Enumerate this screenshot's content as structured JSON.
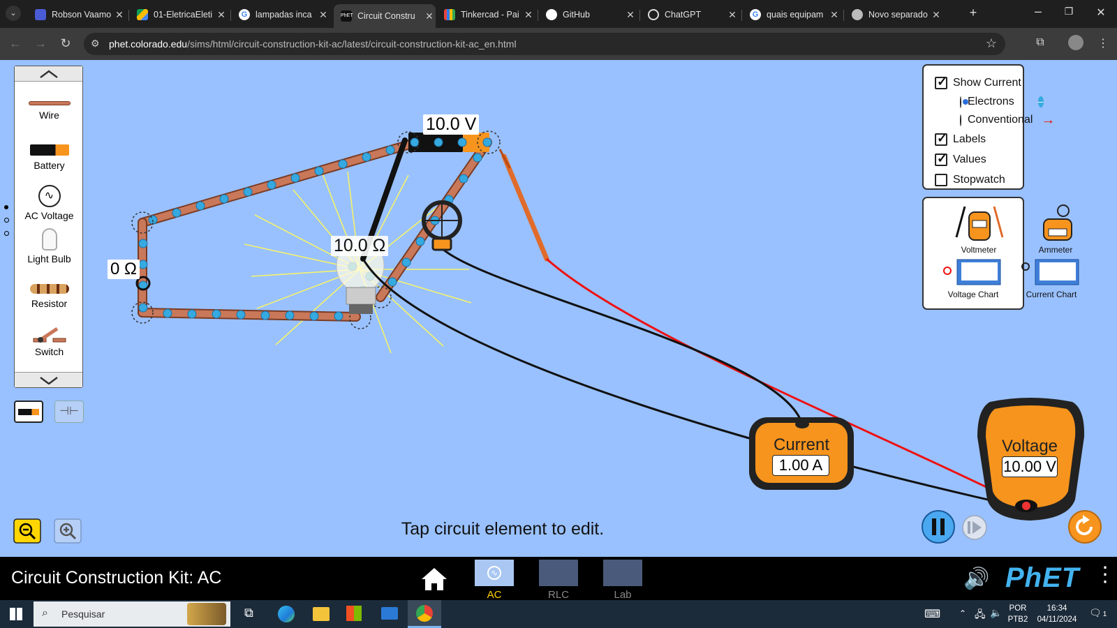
{
  "browser": {
    "tabs": [
      {
        "title": "Robson Vaamo",
        "color": "#4a5bd6"
      },
      {
        "title": "01-EletricaEleti",
        "color": "#34a853"
      },
      {
        "title": "lampadas inca",
        "color": "#ffffff"
      },
      {
        "title": "Circuit Constru",
        "color": "#111111"
      },
      {
        "title": "Tinkercad - Pai",
        "color": "#e8453c"
      },
      {
        "title": "GitHub",
        "color": "#ffffff"
      },
      {
        "title": "ChatGPT",
        "color": "#ffffff"
      },
      {
        "title": "quais equipam",
        "color": "#ffffff"
      },
      {
        "title": "Novo separado",
        "color": "#ffffff"
      }
    ],
    "url_domain": "phet.colorado.edu",
    "url_path": "/sims/html/circuit-construction-kit-ac/latest/circuit-construction-kit-ac_en.html"
  },
  "toolbox": {
    "items": [
      "Wire",
      "Battery",
      "AC Voltage",
      "Light Bulb",
      "Resistor",
      "Switch"
    ]
  },
  "options": {
    "show_current": "Show Current",
    "electrons": "Electrons",
    "conventional": "Conventional",
    "labels": "Labels",
    "values": "Values",
    "stopwatch": "Stopwatch"
  },
  "tools": {
    "voltmeter": "Voltmeter",
    "ammeter": "Ammeter",
    "voltage_chart": "Voltage Chart",
    "current_chart": "Current Chart"
  },
  "circuit": {
    "battery_label": "10.0 V",
    "bulb_label": "10.0 Ω",
    "wire_label": "0 Ω"
  },
  "meters": {
    "current_title": "Current",
    "current_value": "1.00 A",
    "voltage_title": "Voltage",
    "voltage_value": "10.00 V"
  },
  "status_text": "Tap circuit element to edit.",
  "sim_title": "Circuit Construction Kit: AC",
  "screens": [
    "AC Voltage",
    "RLC",
    "Lab"
  ],
  "taskbar": {
    "search_placeholder": "Pesquisar",
    "lang_top": "POR",
    "lang_bottom": "PTB2",
    "time": "16:34",
    "date": "04/11/2024",
    "notifications": "1"
  },
  "colors": {
    "sim_bg": "#99c1ff",
    "meter_orange": "#f7941d",
    "active_screen": "#ffd300"
  }
}
